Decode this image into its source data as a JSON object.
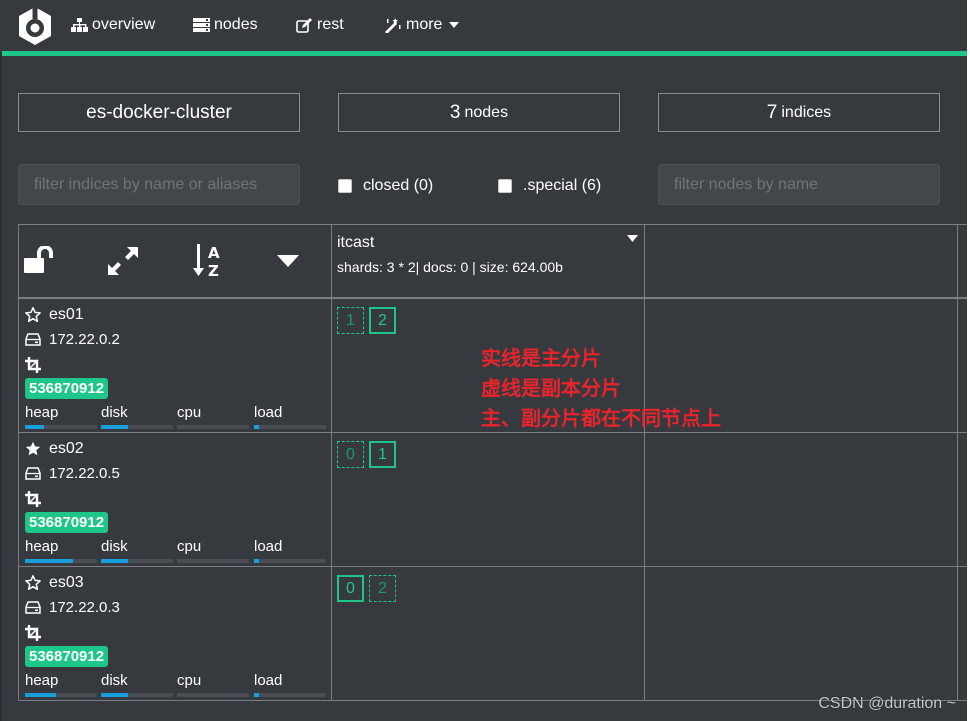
{
  "nav": {
    "logo": "elasticsearch-head-logo",
    "items": [
      {
        "label": "overview",
        "icon": "sitemap-icon"
      },
      {
        "label": "nodes",
        "icon": "server-icon"
      },
      {
        "label": "rest",
        "icon": "edit-icon"
      },
      {
        "label": "more",
        "icon": "magic-wand-icon",
        "has_dropdown": true
      }
    ],
    "accent_color": "#1fc689"
  },
  "stats": {
    "cluster_name": "es-docker-cluster",
    "nodes_count": "3",
    "nodes_label": "nodes",
    "indices_count": "7",
    "indices_label": "indices"
  },
  "filters": {
    "indices_placeholder": "filter indices by name or aliases",
    "indices_value": "",
    "closed_label": "closed (0)",
    "closed_checked": false,
    "special_label": ".special (6)",
    "special_checked": false,
    "nodes_placeholder": "filter nodes by name",
    "nodes_value": ""
  },
  "table_header": {
    "icons": [
      "unlock-icon",
      "expand-icon",
      "sort-alpha-icon",
      "caret-down-icon"
    ],
    "index": {
      "name": "itcast",
      "meta": "shards: 3 * 2| docs: 0 | size: 624.00b"
    }
  },
  "nodes": [
    {
      "name": "es01",
      "master": false,
      "ip": "172.22.0.2",
      "badge": "536870912",
      "metrics": [
        {
          "label": "heap",
          "fill": 0.27
        },
        {
          "label": "disk",
          "fill": 0.37
        },
        {
          "label": "cpu",
          "fill": 0.0
        },
        {
          "label": "load",
          "fill": 0.07
        }
      ],
      "shards": [
        {
          "id": "1",
          "type": "replica"
        },
        {
          "id": "2",
          "type": "primary"
        }
      ]
    },
    {
      "name": "es02",
      "master": true,
      "ip": "172.22.0.5",
      "badge": "536870912",
      "metrics": [
        {
          "label": "heap",
          "fill": 0.67
        },
        {
          "label": "disk",
          "fill": 0.37
        },
        {
          "label": "cpu",
          "fill": 0.0
        },
        {
          "label": "load",
          "fill": 0.07
        }
      ],
      "shards": [
        {
          "id": "0",
          "type": "replica"
        },
        {
          "id": "1",
          "type": "primary"
        }
      ]
    },
    {
      "name": "es03",
      "master": false,
      "ip": "172.22.0.3",
      "badge": "536870912",
      "metrics": [
        {
          "label": "heap",
          "fill": 0.43
        },
        {
          "label": "disk",
          "fill": 0.37
        },
        {
          "label": "cpu",
          "fill": 0.0
        },
        {
          "label": "load",
          "fill": 0.07
        }
      ],
      "shards": [
        {
          "id": "0",
          "type": "primary"
        },
        {
          "id": "2",
          "type": "replica"
        }
      ]
    }
  ],
  "annotation": {
    "lines": [
      "实线是主分片",
      "虚线是副本分片",
      "主、副分片都在不同节点上"
    ],
    "color": "#e8242c"
  },
  "watermark": "CSDN @duration ~"
}
